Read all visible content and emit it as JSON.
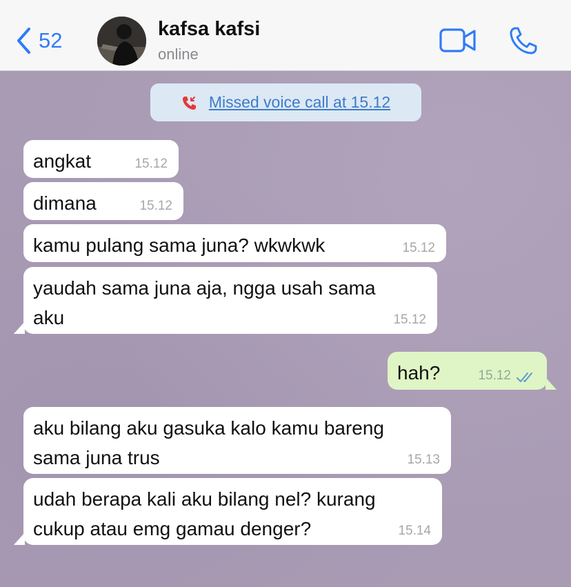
{
  "header": {
    "back_count": "52",
    "contact_name": "kafsa kafsi",
    "status": "online"
  },
  "icons": {
    "back": "chevron-left-icon",
    "video": "video-camera-icon",
    "call": "phone-icon",
    "missed_call": "missed-call-icon",
    "read": "double-check-icon"
  },
  "colors": {
    "accent": "#2f7cf6",
    "missed": "#e53935",
    "outgoing_bubble": "#dff5c5",
    "incoming_bubble": "#ffffff"
  },
  "system_message": "Missed voice call at 15.12",
  "messages": [
    {
      "direction": "in",
      "text": "angkat",
      "time": "15.12"
    },
    {
      "direction": "in",
      "text": "dimana",
      "time": "15.12"
    },
    {
      "direction": "in",
      "text": "kamu pulang sama juna? wkwkwk",
      "time": "15.12"
    },
    {
      "direction": "in",
      "text_line1": "yaudah sama juna aja, ngga usah sama",
      "text_line2": "aku",
      "time": "15.12"
    },
    {
      "direction": "out",
      "text": "hah?",
      "time": "15.12",
      "status": "read"
    },
    {
      "direction": "in",
      "text_line1": "aku bilang aku gasuka kalo kamu bareng",
      "text_line2": "sama juna trus",
      "time": "15.13"
    },
    {
      "direction": "in",
      "text_line1": "udah berapa kali aku bilang nel? kurang",
      "text_line2": "cukup atau emg gamau denger?",
      "time": "15.14"
    }
  ]
}
